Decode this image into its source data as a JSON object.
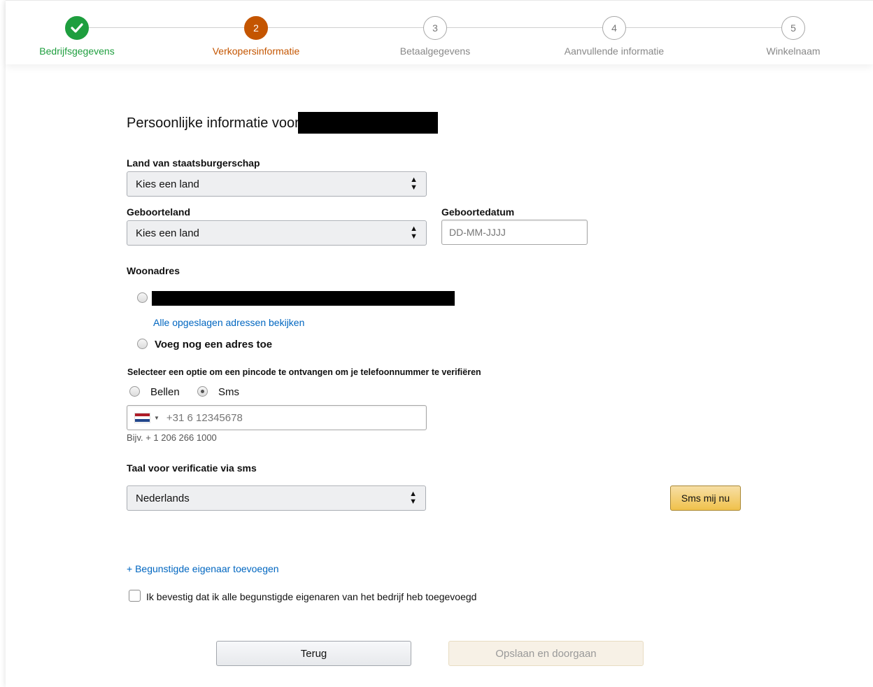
{
  "stepper": {
    "steps": [
      {
        "number": "",
        "label": "Bedrijfsgegevens",
        "state": "done"
      },
      {
        "number": "2",
        "label": "Verkopersinformatie",
        "state": "active"
      },
      {
        "number": "3",
        "label": "Betaalgegevens",
        "state": "todo"
      },
      {
        "number": "4",
        "label": "Aanvullende informatie",
        "state": "todo"
      },
      {
        "number": "5",
        "label": "Winkelnaam",
        "state": "todo"
      }
    ]
  },
  "form": {
    "heading": "Persoonlijke informatie voor",
    "citizenship": {
      "label": "Land van staatsburgerschap",
      "value": "Kies een land"
    },
    "birth_country": {
      "label": "Geboorteland",
      "value": "Kies een land"
    },
    "birth_date": {
      "label": "Geboortedatum",
      "placeholder": "DD-MM-JJJJ"
    },
    "address": {
      "label": "Woonadres",
      "view_all_link": "Alle opgeslagen adressen bekijken",
      "add_address": "Voeg nog een adres toe"
    },
    "pin": {
      "label": "Selecteer een optie om een pincode te ontvangen om je telefoonnummer te verifiëren",
      "option_call": "Bellen",
      "option_sms": "Sms",
      "selected": "Sms",
      "phone_placeholder": "+31 6 12345678",
      "example": "Bijv. + 1 206 266 1000"
    },
    "sms_language": {
      "label": "Taal voor verificatie via sms",
      "value": "Nederlands"
    },
    "sms_button": "Sms mij nu",
    "add_owner_link": "+ Begunstigde eigenaar toevoegen",
    "confirm_checkbox": {
      "label": "Ik bevestig dat ik alle begunstigde eigenaren van het bedrijf heb toegevoegd",
      "checked": false
    },
    "back_button": "Terug",
    "save_button": "Opslaan en doorgaan"
  },
  "colors": {
    "done": "#1e9e3e",
    "active": "#c45500",
    "link": "#0066c0",
    "sms_button": "#f0c14b"
  }
}
